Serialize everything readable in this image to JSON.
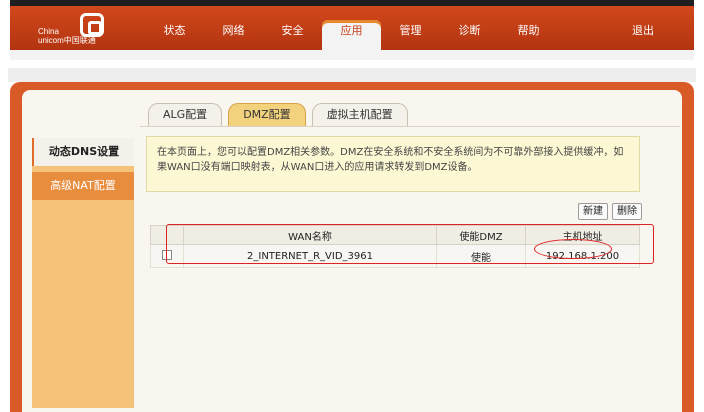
{
  "brand": {
    "line1": "China",
    "line2": "unicom中国联通"
  },
  "nav": {
    "items": [
      {
        "label": "状态"
      },
      {
        "label": "网络"
      },
      {
        "label": "安全"
      },
      {
        "label": "应用"
      },
      {
        "label": "管理"
      },
      {
        "label": "诊断"
      },
      {
        "label": "帮助"
      }
    ],
    "active": "应用",
    "logout": "退出"
  },
  "tabs": [
    {
      "label": "ALG配置"
    },
    {
      "label": "DMZ配置"
    },
    {
      "label": "虚拟主机配置"
    }
  ],
  "active_tab": "DMZ配置",
  "sidebar": {
    "items": [
      {
        "label": "动态DNS设置"
      },
      {
        "label": "高级NAT配置"
      }
    ]
  },
  "info_text": "在本页面上，您可以配置DMZ相关参数。DMZ在安全系统和不安全系统间为不可靠外部接入提供缓冲，如果WAN口没有端口映射表，从WAN口进入的应用请求转发到DMZ设备。",
  "buttons": {
    "new": "新建",
    "delete": "删除"
  },
  "table": {
    "headers": [
      "WAN名称",
      "使能DMZ",
      "主机地址"
    ],
    "rows": [
      {
        "wan": "2_INTERNET_R_VID_3961",
        "enable": "使能",
        "host": "192.168.1.200"
      }
    ]
  },
  "colors": {
    "brand_orange": "#d2481c",
    "annotation_red": "#dd2222",
    "sidebar_orange": "#f5c27a"
  }
}
